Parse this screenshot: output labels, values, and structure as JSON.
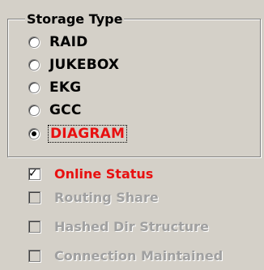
{
  "storage_type": {
    "title": "Storage Type",
    "options": [
      {
        "label": "RAID",
        "selected": false
      },
      {
        "label": "JUKEBOX",
        "selected": false
      },
      {
        "label": "EKG",
        "selected": false
      },
      {
        "label": "GCC",
        "selected": false
      },
      {
        "label": "DIAGRAM",
        "selected": true
      }
    ]
  },
  "checkboxes": [
    {
      "label": "Online Status",
      "checked": true,
      "enabled": true
    },
    {
      "label": "Routing Share",
      "checked": false,
      "enabled": false
    },
    {
      "label": "Hashed Dir Structure",
      "checked": false,
      "enabled": false
    },
    {
      "label": "Connection Maintained",
      "checked": false,
      "enabled": false
    }
  ],
  "colors": {
    "dialog_bg": "#d4d0c8",
    "highlight_text": "#e81010",
    "disabled_text": "#a0a0a0"
  }
}
